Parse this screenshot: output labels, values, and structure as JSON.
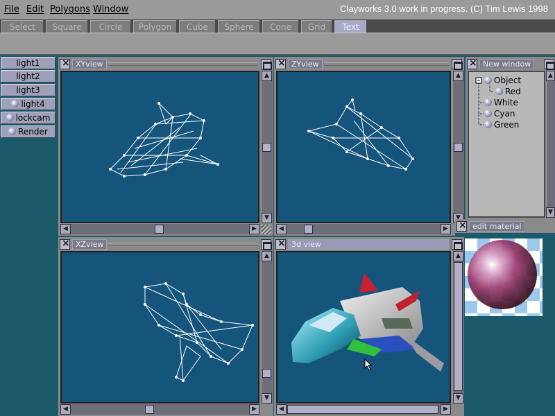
{
  "menubar": {
    "items": [
      "File",
      "Edit",
      "Polygons",
      "Window"
    ],
    "title": "Clayworks 3.0 work in progress. (C) Tim Lewis 1998"
  },
  "tabs": [
    "Select",
    "Square",
    "Circle",
    "Polygon",
    "Cube",
    "Sphere",
    "Cone",
    "Grid",
    "Text"
  ],
  "active_tab": "Text",
  "left_buttons": [
    {
      "label": "light1",
      "icon": null
    },
    {
      "label": "light2",
      "icon": null
    },
    {
      "label": "light3",
      "icon": null
    },
    {
      "label": "light4",
      "icon": "sphere-icon"
    },
    {
      "label": "lockcam",
      "icon": "sphere-icon"
    },
    {
      "label": "Render",
      "icon": "sphere-icon"
    }
  ],
  "viewports": {
    "xy": {
      "title": "XYview"
    },
    "zy": {
      "title": "ZYview"
    },
    "xz": {
      "title": "XZview"
    },
    "view3d": {
      "title": "3d view"
    }
  },
  "tree_window": {
    "title": "New window",
    "items": [
      "Object",
      "Red",
      "White",
      "Cyan",
      "Green"
    ]
  },
  "material_window": {
    "title": "edit material"
  },
  "colors": {
    "desktop": "#1b5a6a",
    "viewport_bg": "#15557c",
    "window_gray": "#8a8a8a",
    "wireframe": "#ffffff"
  }
}
